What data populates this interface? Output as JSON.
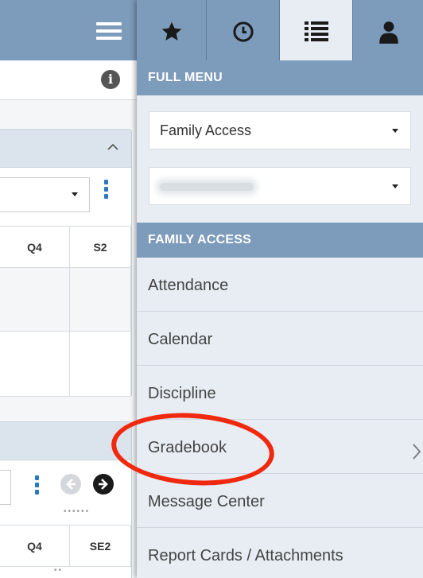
{
  "left_panel": {
    "grid1": {
      "headers": [
        "Q4",
        "S2"
      ]
    },
    "grid2": {
      "headers": [
        "Q4",
        "SE2"
      ]
    }
  },
  "menu": {
    "tabs": [
      {
        "icon": "star-icon"
      },
      {
        "icon": "clock-icon"
      },
      {
        "icon": "list-icon",
        "active": true
      },
      {
        "icon": "person-icon"
      }
    ],
    "full_menu_header": "FULL MENU",
    "app_select_value": "Family Access",
    "student_select_value": "STEVEN A22",
    "family_access_header": "FAMILY ACCESS",
    "items": [
      "Attendance",
      "Calendar",
      "Discipline",
      "Gradebook",
      "Message Center",
      "Report Cards / Attachments"
    ]
  },
  "colors": {
    "header_blue": "#7d9bbb",
    "menu_bg": "#e7edf3",
    "annotation_red": "#f0290e",
    "link_blue": "#2b78c2"
  }
}
